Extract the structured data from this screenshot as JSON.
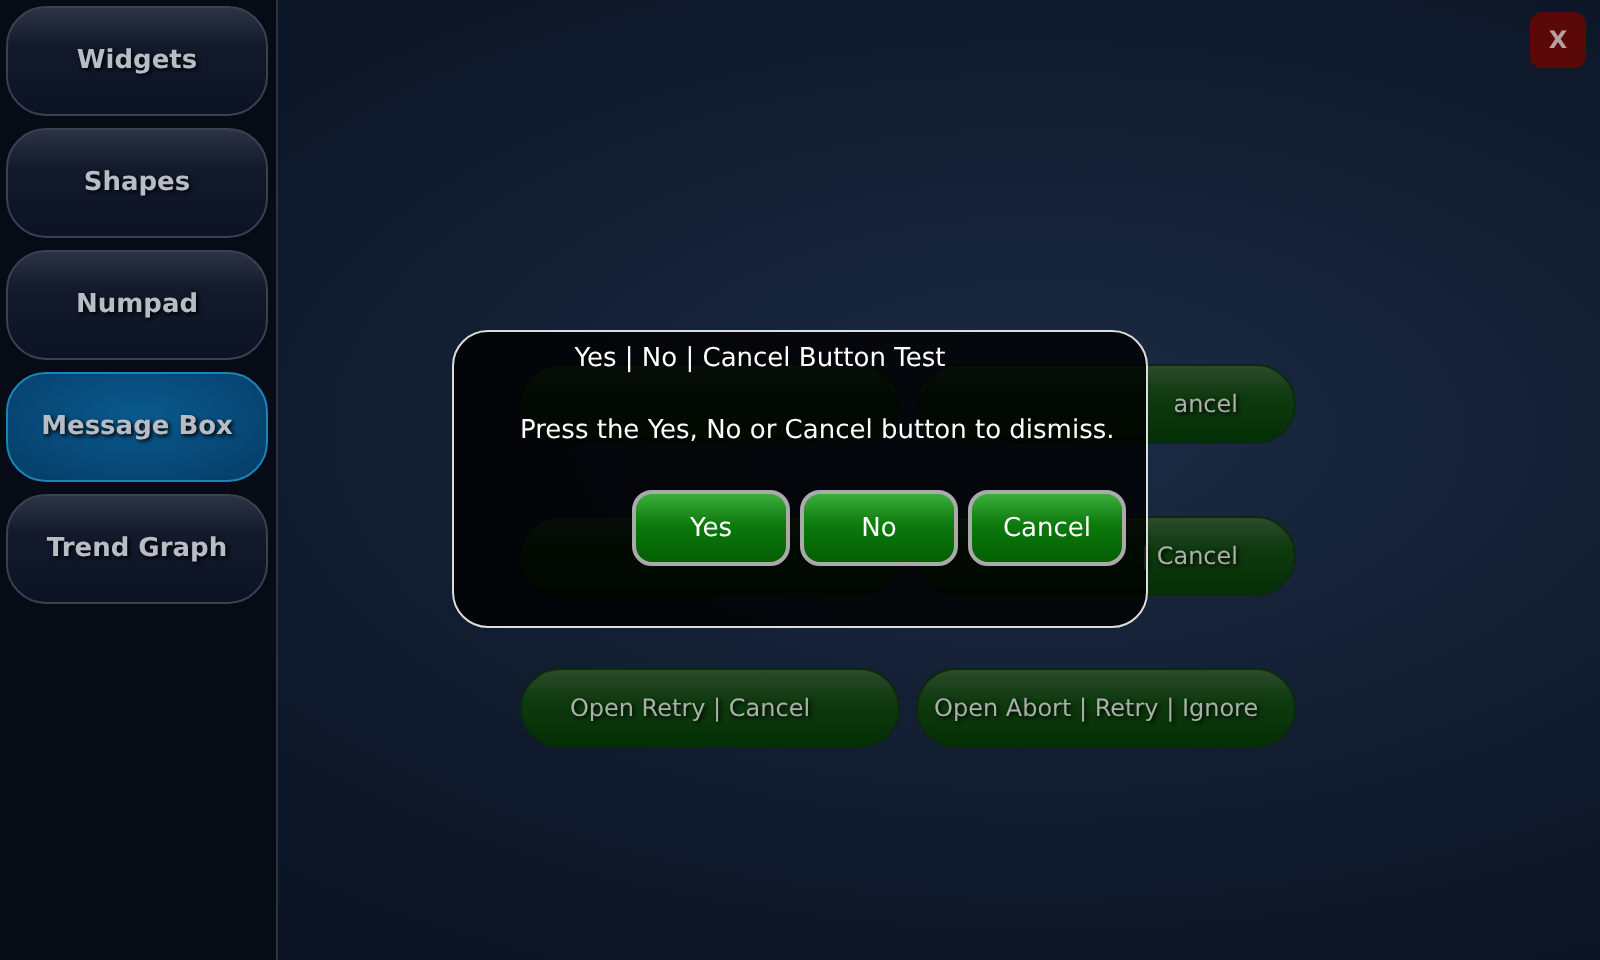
{
  "sidebar": {
    "items": [
      {
        "label": "Widgets",
        "selected": false
      },
      {
        "label": "Shapes",
        "selected": false
      },
      {
        "label": "Numpad",
        "selected": false
      },
      {
        "label": "Message Box",
        "selected": true
      },
      {
        "label": "Trend Graph",
        "selected": false
      }
    ]
  },
  "close_button": {
    "label": "X"
  },
  "buttons": [
    {
      "kind": "hidden"
    },
    {
      "kind": "text",
      "label": "ancel"
    },
    {
      "kind": "hidden"
    },
    {
      "kind": "text",
      "label": "| Cancel"
    },
    {
      "kind": "text",
      "label": "Open Retry | Cancel"
    },
    {
      "kind": "text",
      "label": "Open Abort | Retry | Ignore"
    }
  ],
  "dialog": {
    "title": "Yes | No | Cancel Button Test",
    "message": "Press the Yes, No or Cancel button to dismiss.",
    "buttons": [
      "Yes",
      "No",
      "Cancel"
    ]
  }
}
